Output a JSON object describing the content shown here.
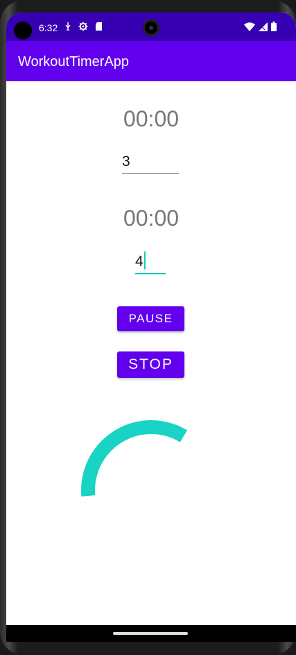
{
  "status_bar": {
    "time": "6:32",
    "icons_left": [
      "usb-icon",
      "settings-icon",
      "sd-card-icon"
    ],
    "icons_right": [
      "wifi-icon",
      "signal-icon",
      "battery-icon"
    ]
  },
  "app_bar": {
    "title": "WorkoutTimerApp"
  },
  "main": {
    "timer1": "00:00",
    "input1_value": "3",
    "timer2": "00:00",
    "input2_value": "4",
    "pause_label": "PAUSE",
    "stop_label": "STOP",
    "progress": {
      "fraction": 0.35,
      "color": "#19d3c5"
    }
  },
  "colors": {
    "status_bar": "#3700b3",
    "app_bar": "#6200ee",
    "button": "#6200ee",
    "accent": "#19c9c1"
  }
}
